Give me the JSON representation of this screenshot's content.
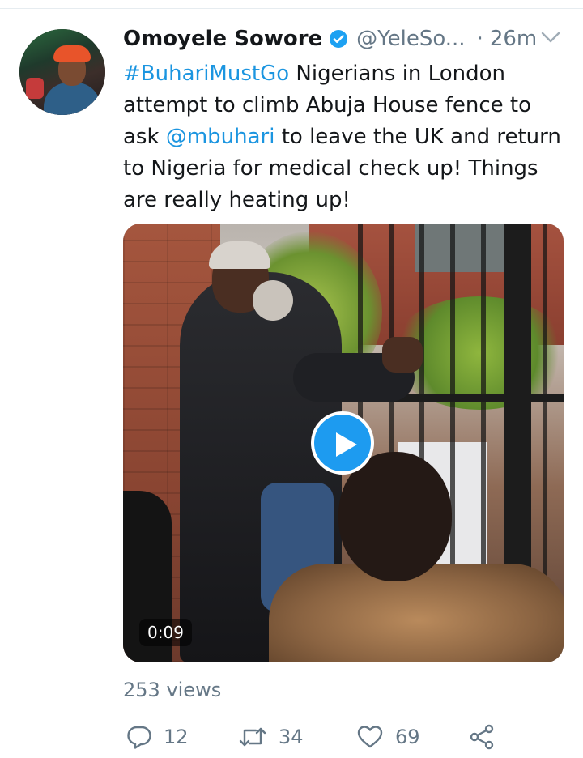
{
  "tweet": {
    "author_name": "Omoyele Sowore",
    "handle": "@YeleSo...",
    "separator": "·",
    "time": "26m",
    "text_parts": {
      "hashtag": "#BuhariMustGo",
      "part1": " Nigerians in London attempt to climb Abuja House fence to ask ",
      "mention": "@mbuhari",
      "part2": " to leave the UK and return to Nigeria for medical check up! Things are really heating up!"
    },
    "video": {
      "duration": "0:09"
    },
    "views": "253 views",
    "actions": {
      "reply_count": "12",
      "retweet_count": "34",
      "like_count": "69"
    }
  },
  "icons": {
    "verified": "verified-badge-icon",
    "caret": "chevron-down-icon",
    "reply": "reply-icon",
    "retweet": "retweet-icon",
    "like": "heart-icon",
    "share": "share-icon",
    "play": "play-icon"
  },
  "colors": {
    "link": "#1b95e0",
    "secondary_text": "#657786",
    "verified": "#1da1f2",
    "play_button": "#1d9bf0"
  }
}
